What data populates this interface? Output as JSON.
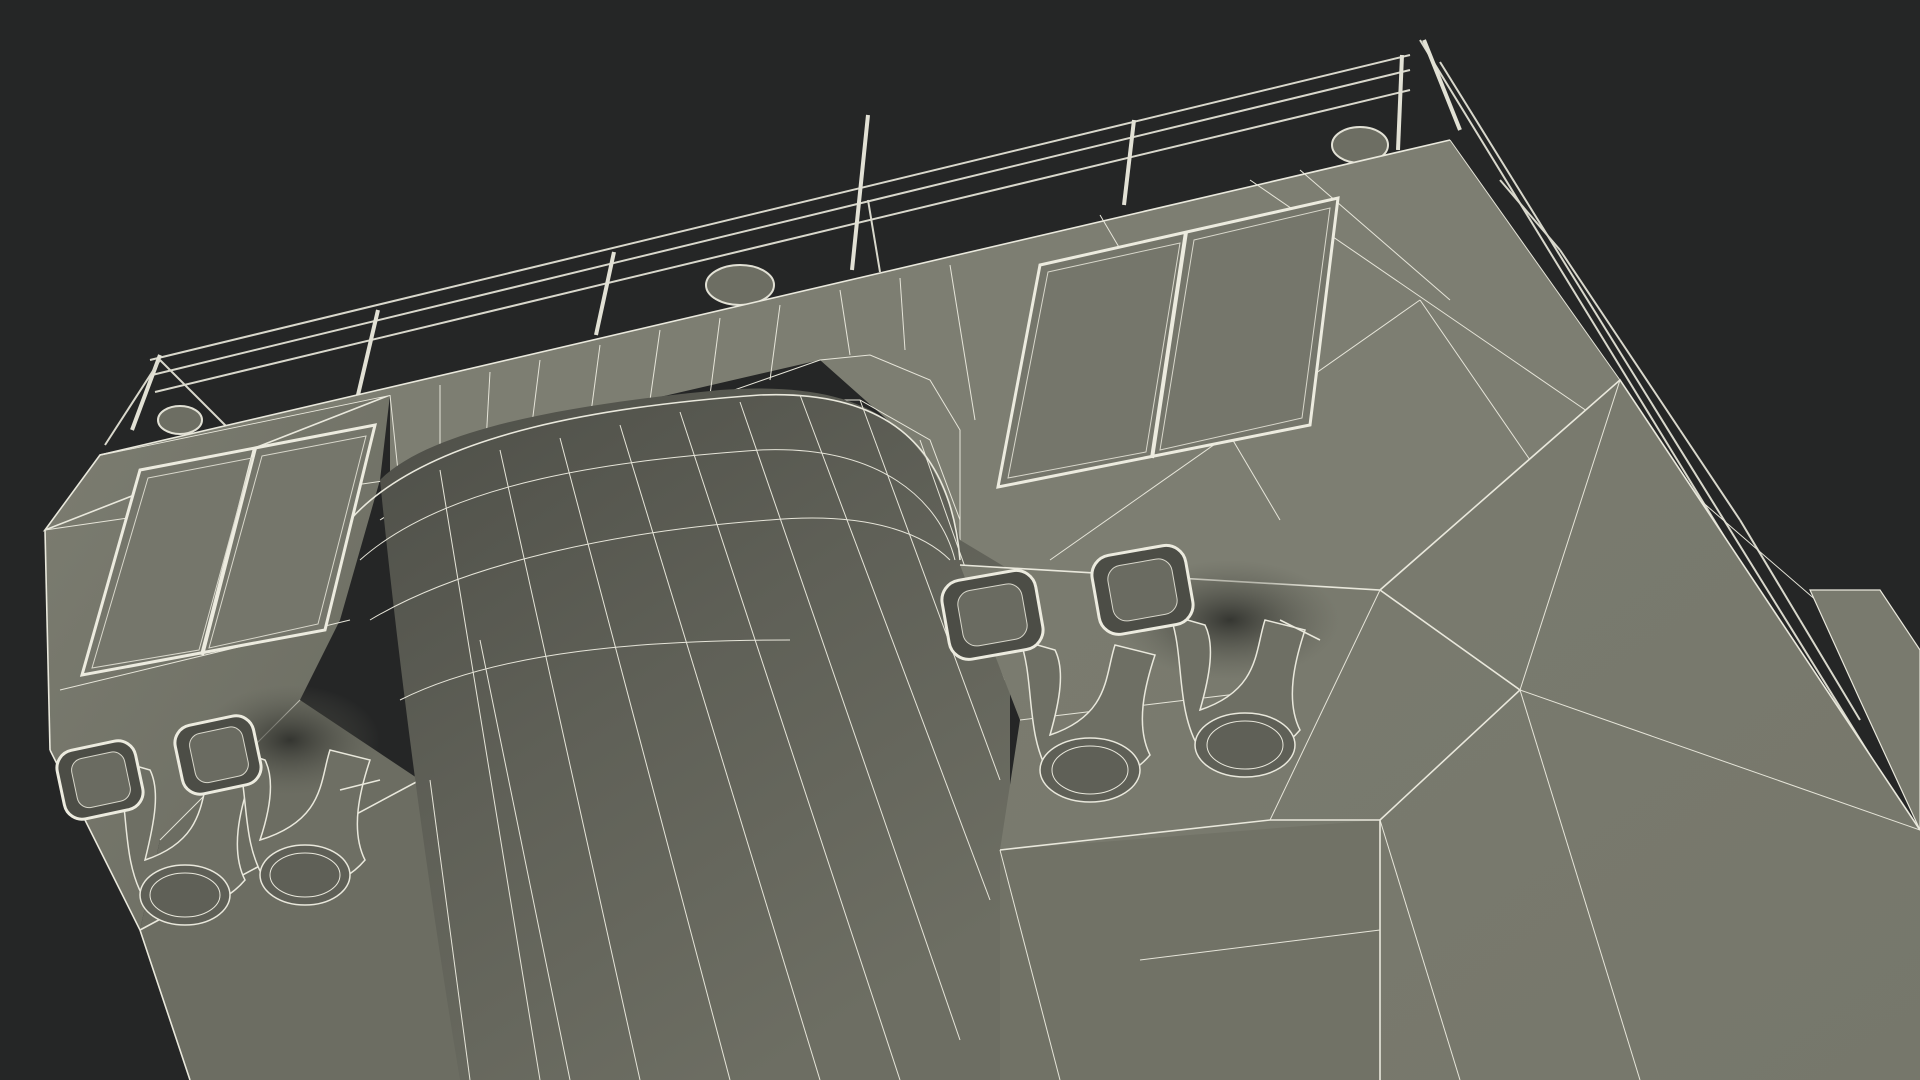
{
  "scene": {
    "subject": "mobile-launcher-platform-wireframe",
    "colors": {
      "background": "#252626",
      "surface_light": "#7b7c70",
      "surface_mid": "#6f7065",
      "surface_dark": "#55564d",
      "wire": "#e9e8dc"
    }
  }
}
